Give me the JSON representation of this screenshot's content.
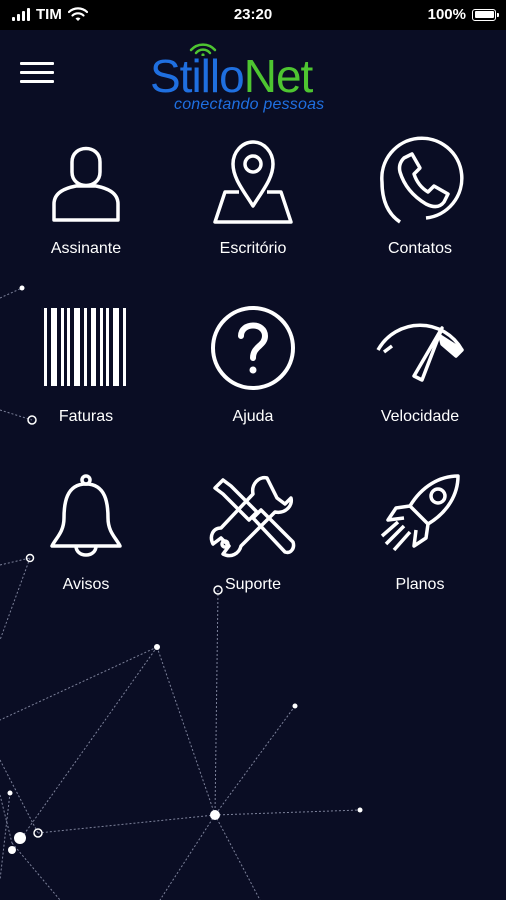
{
  "status_bar": {
    "carrier": "TIM",
    "time": "23:20",
    "battery": "100%"
  },
  "header": {
    "logo_part1": "Stillo",
    "logo_part2": "Net",
    "slogan": "conectando pessoas"
  },
  "menu": [
    {
      "label": "Assinante",
      "icon": "user-icon"
    },
    {
      "label": "Escritório",
      "icon": "map-pin-icon"
    },
    {
      "label": "Contatos",
      "icon": "phone-icon"
    },
    {
      "label": "Faturas",
      "icon": "barcode-icon"
    },
    {
      "label": "Ajuda",
      "icon": "help-icon"
    },
    {
      "label": "Velocidade",
      "icon": "speedometer-icon"
    },
    {
      "label": "Avisos",
      "icon": "bell-icon"
    },
    {
      "label": "Suporte",
      "icon": "tools-icon"
    },
    {
      "label": "Planos",
      "icon": "rocket-icon"
    }
  ],
  "colors": {
    "background": "#0a0d24",
    "brand_blue": "#1f6fe0",
    "brand_green": "#4ec531"
  }
}
